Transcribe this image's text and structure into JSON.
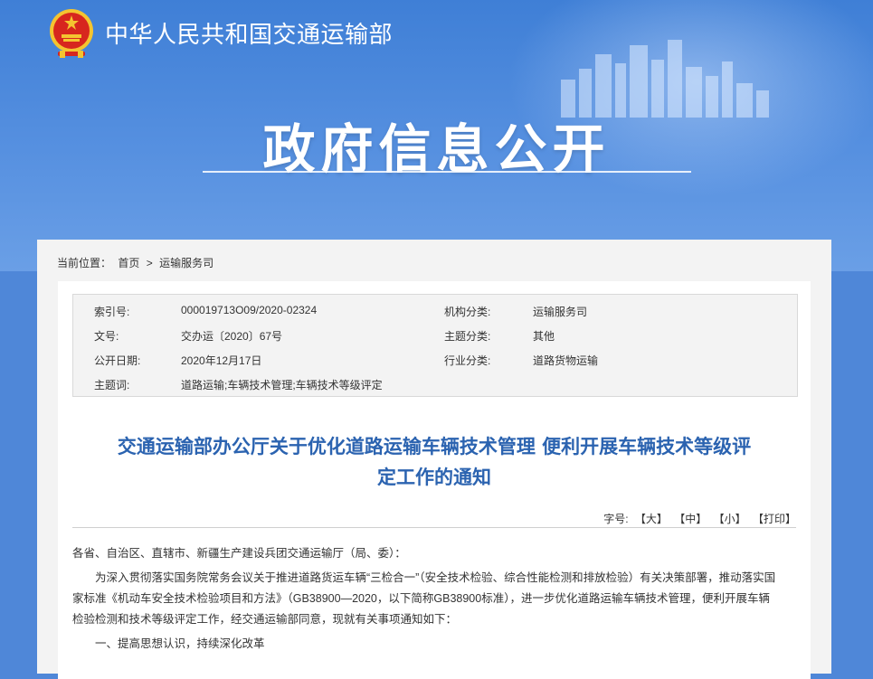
{
  "header": {
    "ministry_name": "中华人民共和国交通运输部",
    "banner_title": "政府信息公开"
  },
  "breadcrumb": {
    "label": "当前位置：",
    "home": "首页",
    "sep": ">",
    "current": "运输服务司"
  },
  "meta": {
    "index_label": "索引号:",
    "index_value": "000019713O09/2020-02324",
    "org_label": "机构分类:",
    "org_value": "运输服务司",
    "doc_label": "文号:",
    "doc_value": "交办运〔2020〕67号",
    "topic_label": "主题分类:",
    "topic_value": "其他",
    "date_label": "公开日期:",
    "date_value": "2020年12月17日",
    "industry_label": "行业分类:",
    "industry_value": "道路货物运输",
    "keywords_label": "主题词:",
    "keywords_value": "道路运输;车辆技术管理;车辆技术等级评定"
  },
  "article": {
    "title_line1": "交通运输部办公厅关于优化道路运输车辆技术管理 便利开展车辆技术等级评",
    "title_line2": "定工作的通知",
    "font_size_label": "字号:",
    "font_large": "【大】",
    "font_medium": "【中】",
    "font_small": "【小】",
    "print": "【打印】",
    "salutation": "各省、自治区、直辖市、新疆生产建设兵团交通运输厅（局、委）：",
    "paragraph1": "为深入贯彻落实国务院常务会议关于推进道路货运车辆“三检合一”（安全技术检验、综合性能检测和排放检验）有关决策部署，推动落实国家标准《机动车安全技术检验项目和方法》（GB38900—2020，以下简称GB38900标准），进一步优化道路运输车辆技术管理，便利开展车辆检验检测和技术等级评定工作，经交通运输部同意，现就有关事项通知如下：",
    "section1": "一、提高思想认识，持续深化改革"
  },
  "colors": {
    "banner": "#4f87d8",
    "title_blue": "#2b63b0",
    "emblem_red": "#d7261e",
    "emblem_gold": "#f4c430"
  }
}
